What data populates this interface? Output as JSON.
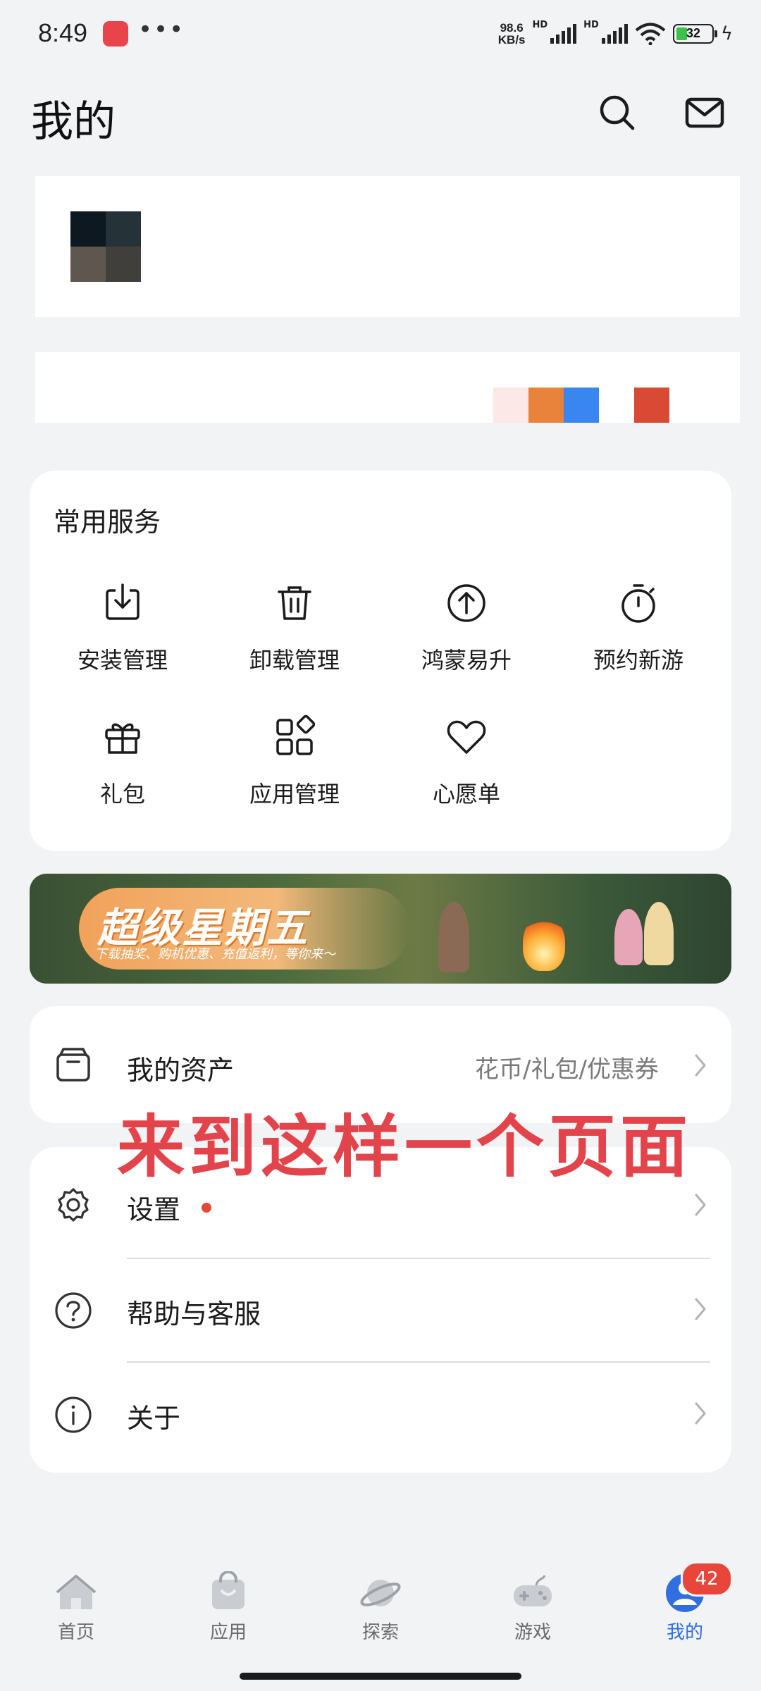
{
  "status_bar": {
    "time": "8:49",
    "network_speed_value": "98.6",
    "network_speed_unit": "KB/s",
    "hd1": "HD",
    "hd2": "HD",
    "battery": "32",
    "battery_level": 0.32
  },
  "header": {
    "title": "我的",
    "search_icon": "search-icon",
    "message_icon": "mail-icon"
  },
  "services": {
    "title": "常用服务",
    "items": [
      {
        "label": "安装管理",
        "icon": "install-icon"
      },
      {
        "label": "卸载管理",
        "icon": "trash-icon"
      },
      {
        "label": "鸿蒙易升",
        "icon": "upgrade-icon"
      },
      {
        "label": "预约新游",
        "icon": "stopwatch-icon"
      },
      {
        "label": "礼包",
        "icon": "gift-icon"
      },
      {
        "label": "应用管理",
        "icon": "apps-icon"
      },
      {
        "label": "心愿单",
        "icon": "heart-icon"
      }
    ]
  },
  "banner": {
    "title": "超级星期五",
    "subtitle": "下载抽奖、购机优惠、充值返利，等你来～"
  },
  "assets": {
    "label": "我的资产",
    "detail": "花币/礼包/优惠券"
  },
  "overlay_note": "来到这样一个页面",
  "settings_list": [
    {
      "label": "设置",
      "icon": "gear-icon",
      "has_dot": true
    },
    {
      "label": "帮助与客服",
      "icon": "help-icon",
      "has_dot": false
    },
    {
      "label": "关于",
      "icon": "info-icon",
      "has_dot": false
    }
  ],
  "tabs": [
    {
      "label": "首页",
      "icon": "home-icon"
    },
    {
      "label": "应用",
      "icon": "app-store-icon"
    },
    {
      "label": "探索",
      "icon": "planet-icon"
    },
    {
      "label": "游戏",
      "icon": "gamepad-icon"
    },
    {
      "label": "我的",
      "icon": "profile-icon",
      "active": true
    }
  ],
  "tab_badge": "42",
  "colors": {
    "accent": "#2f6fe0",
    "badge": "#e8463a",
    "overlay_text": "#e3434b",
    "background": "#f1f3f5"
  }
}
